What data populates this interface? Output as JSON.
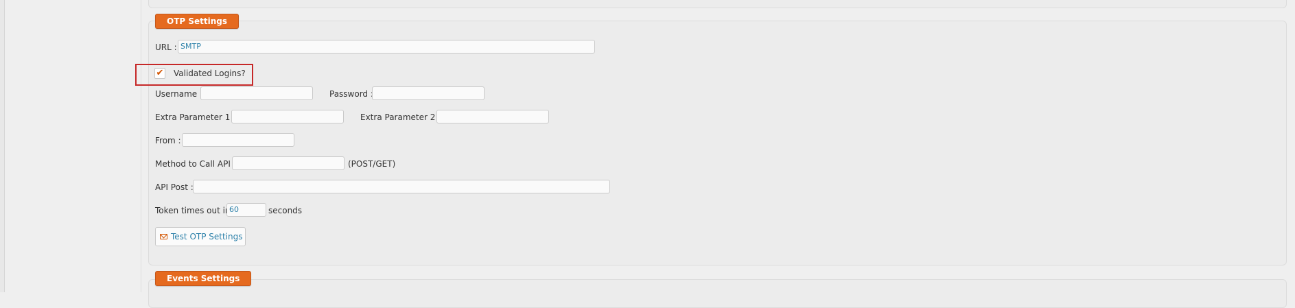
{
  "otp_settings": {
    "title": "OTP Settings",
    "url_label": "URL :",
    "url_value": "SMTP",
    "validated_logins_label": "Validated Logins?",
    "validated_logins_checked": true,
    "username_label": "Username :",
    "username_value": "",
    "password_label": "Password :",
    "password_value": "",
    "extra_param1_label": "Extra Parameter 1 :",
    "extra_param1_value": "",
    "extra_param2_label": "Extra Parameter 2 :",
    "extra_param2_value": "",
    "from_label": "From :",
    "from_value": "",
    "method_label": "Method to Call API :",
    "method_value": "",
    "method_hint": "(POST/GET)",
    "api_post_label": "API Post :",
    "api_post_value": "",
    "token_label": "Token times out in",
    "token_value": "60",
    "token_unit": "seconds",
    "test_button_label": "Test OTP Settings"
  },
  "events_settings": {
    "title": "Events Settings"
  },
  "colors": {
    "legend_orange": "#e56a1f",
    "link_blue": "#2a7fa8",
    "highlight_red": "#c62828"
  },
  "icons": {
    "checkbox": "checkmark-icon",
    "test_button": "envelope-icon"
  }
}
